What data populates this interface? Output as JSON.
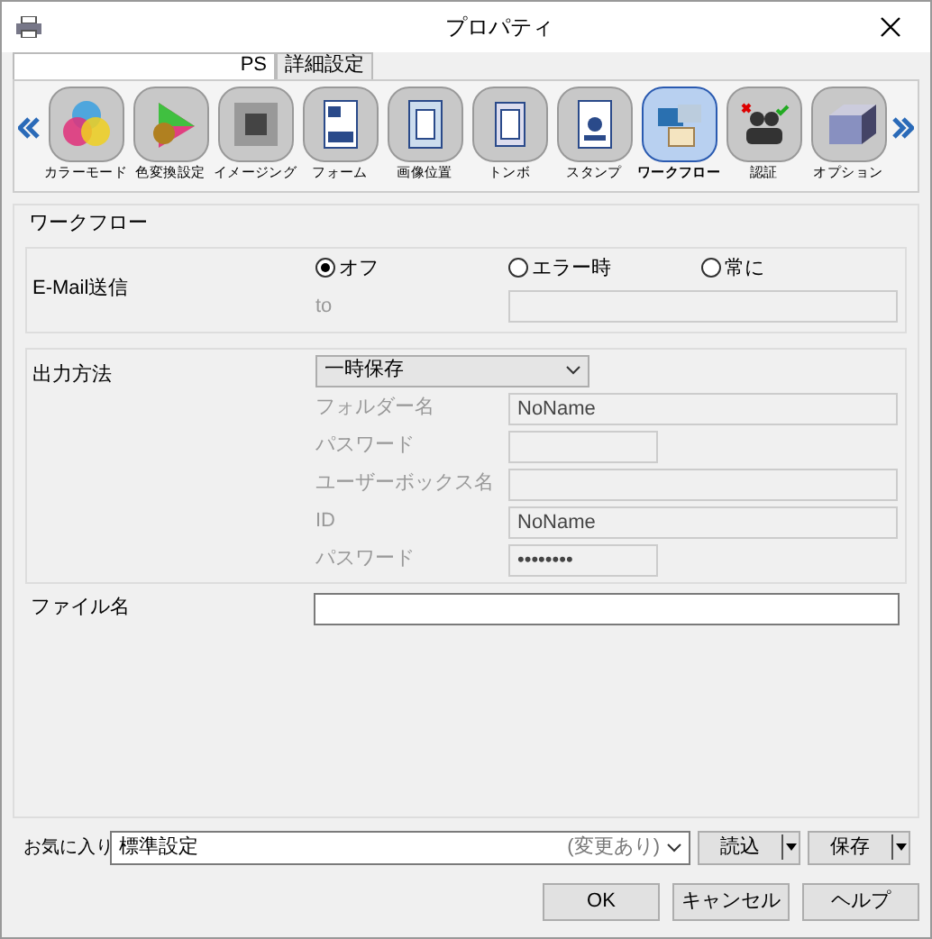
{
  "window": {
    "title": "プロパティ"
  },
  "tabs": [
    {
      "label": "PS",
      "selected": true
    },
    {
      "label": "詳細設定",
      "selected": false
    }
  ],
  "toolbar": [
    {
      "label": "カラーモード",
      "selected": false
    },
    {
      "label": "色変換設定",
      "selected": false
    },
    {
      "label": "イメージング",
      "selected": false
    },
    {
      "label": "フォーム",
      "selected": false
    },
    {
      "label": "画像位置",
      "selected": false
    },
    {
      "label": "トンボ",
      "selected": false
    },
    {
      "label": "スタンプ",
      "selected": false
    },
    {
      "label": "ワークフロー",
      "selected": true
    },
    {
      "label": "認証",
      "selected": false
    },
    {
      "label": "オプション",
      "selected": false
    }
  ],
  "section": {
    "title": "ワークフロー",
    "email": {
      "label": "E-Mail送信",
      "options": [
        {
          "label": "オフ",
          "selected": true
        },
        {
          "label": "エラー時",
          "selected": false
        },
        {
          "label": "常に",
          "selected": false
        }
      ],
      "to": {
        "label": "to",
        "disabled": true
      }
    },
    "output": {
      "label": "出力方法",
      "value": "一時保存",
      "fields": [
        {
          "label": "フォルダー名",
          "value": "NoName",
          "kind": "long",
          "disabled": true
        },
        {
          "label": "パスワード",
          "kind": "short",
          "disabled": true
        },
        {
          "label": "ユーザーボックス名",
          "kind": "long",
          "disabled": true
        },
        {
          "label": "ID",
          "value": "NoName",
          "kind": "long",
          "disabled": true
        },
        {
          "label": "パスワード",
          "value": "••••••••",
          "kind": "short",
          "disabled": true
        }
      ]
    },
    "filename": {
      "label": "ファイル名"
    }
  },
  "favorites": {
    "label": "お気に入り",
    "value": "標準設定",
    "note": "(変更あり)",
    "buttons": [
      "読込",
      "保存"
    ]
  },
  "buttons": [
    "OK",
    "キャンセル",
    "ヘルプ"
  ]
}
